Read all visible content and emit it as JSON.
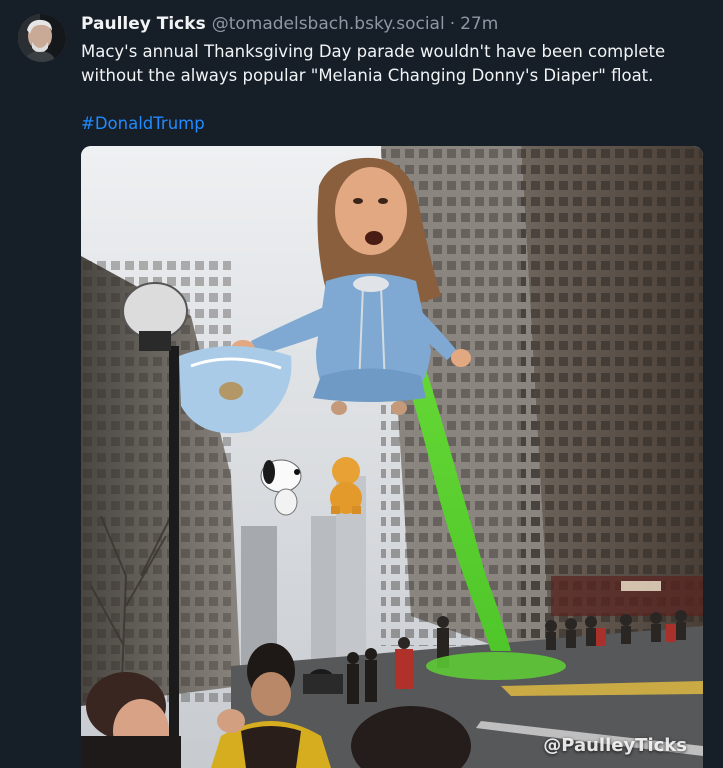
{
  "post": {
    "author": {
      "name": "Paulley Ticks",
      "handle": "@tomadelsbach.bsky.social"
    },
    "separator": "·",
    "timestamp": "27m",
    "text": "Macy's annual Thanksgiving Day parade wouldn't have been complete without the always popular \"Melania Changing Donny's Diaper\" float.",
    "hashtag": "#DonaldTrump",
    "image": {
      "watermark": "@PaulleyTicks"
    }
  },
  "colors": {
    "background": "#161e27",
    "text": "#f1f3f5",
    "muted": "#8d98a5",
    "link": "#208bfe"
  }
}
